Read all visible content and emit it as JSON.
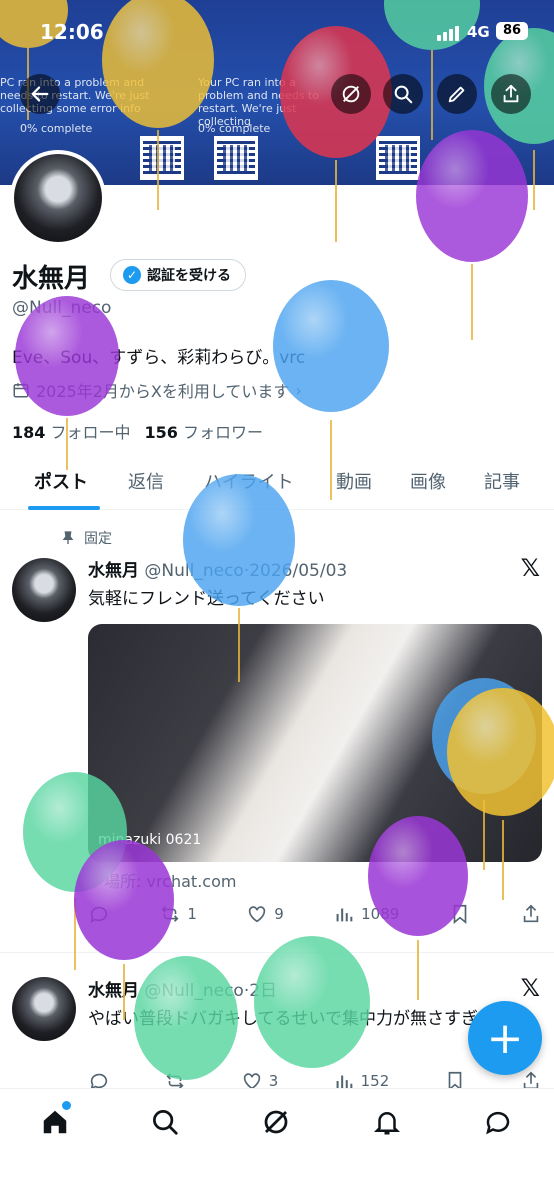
{
  "status_bar": {
    "time": "12:06",
    "network": "4G",
    "battery": "86"
  },
  "profile": {
    "name": "水無月",
    "verify_label": "認証を受ける",
    "handle": "@Null_neco",
    "bio": "Eve、Sou、すずら、彩莉わらび。vrc",
    "joined": "2025年2月からXを利用しています",
    "following_count": "184",
    "following_label": "フォロー中",
    "followers_count": "156",
    "followers_label": "フォロワー"
  },
  "tabs": [
    "ポスト",
    "返信",
    "ハイライト",
    "動画",
    "画像",
    "記事"
  ],
  "pinned_label": "固定",
  "posts": [
    {
      "name": "水無月",
      "handle": "@Null_neco",
      "date": "2026/05/03",
      "text": "気軽にフレンド送ってください",
      "media_tag": "minazuki 0621",
      "location": "場所: vrchat.com",
      "retweets": "1",
      "likes": "9",
      "views": "1089"
    },
    {
      "name": "水無月",
      "handle": "@Null_neco",
      "date": "2日",
      "text": "やばい普段ドバガキしてるせいで集中力が無さすぎる",
      "retweets": "",
      "likes": "3",
      "views": "152"
    }
  ],
  "fab_label": "+",
  "icons": {
    "back": "back-arrow-icon",
    "grok": "grok-icon",
    "search": "search-icon",
    "edit": "pencil-icon",
    "share": "share-icon",
    "calendar": "calendar-icon",
    "pin": "pin-icon",
    "x": "x-logo-icon"
  },
  "colors": {
    "accent": "#1d9bf0",
    "text": "#0f1419",
    "muted": "#536471"
  }
}
